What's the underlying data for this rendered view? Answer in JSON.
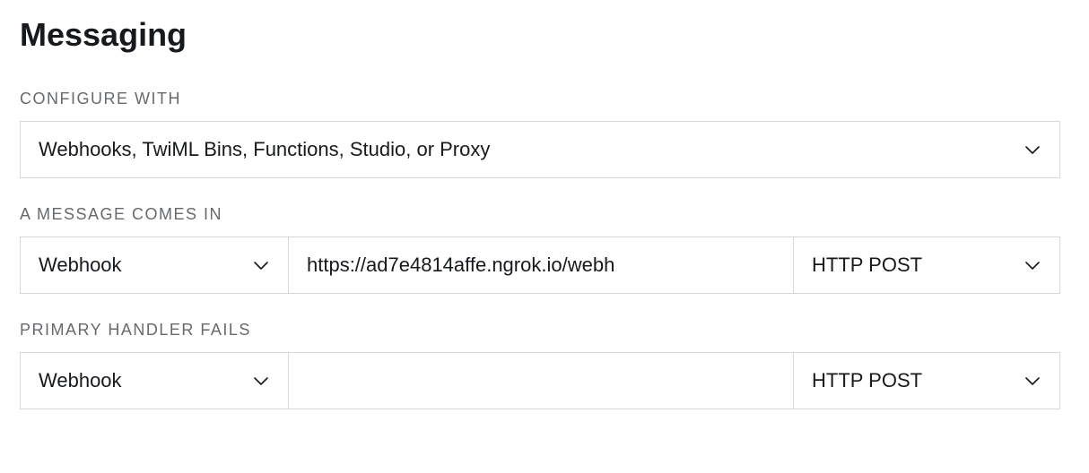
{
  "section": {
    "title": "Messaging"
  },
  "configure_with": {
    "label": "CONFIGURE WITH",
    "selected": "Webhooks, TwiML Bins, Functions, Studio, or Proxy"
  },
  "message_comes_in": {
    "label": "A MESSAGE COMES IN",
    "type_selected": "Webhook",
    "url_value": "https://ad7e4814affe.ngrok.io/webh",
    "method_selected": "HTTP POST"
  },
  "primary_handler_fails": {
    "label": "PRIMARY HANDLER FAILS",
    "type_selected": "Webhook",
    "url_value": "",
    "method_selected": "HTTP POST"
  }
}
